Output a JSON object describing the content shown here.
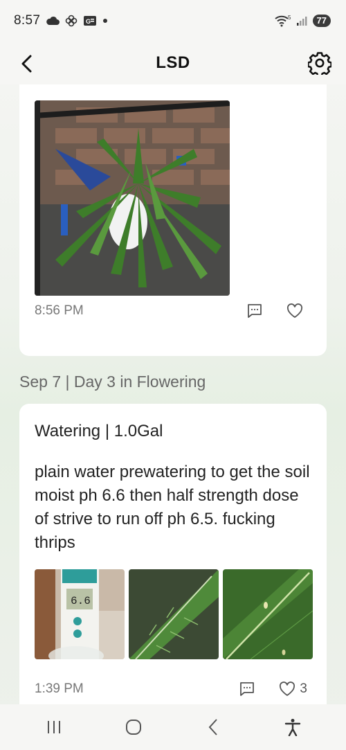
{
  "status_bar": {
    "time": "8:57",
    "icons": [
      "cloud-icon",
      "pinwheel-icon",
      "ge-badge-icon",
      "dot-icon"
    ],
    "wifi_label": "5",
    "battery": "77"
  },
  "header": {
    "title": "LSD",
    "back_icon": "chevron-left-icon",
    "settings_icon": "gear-icon"
  },
  "entries": [
    {
      "time": "8:56 PM",
      "like_count": ""
    },
    {
      "day_header": "Sep 7 | Day 3 in Flowering",
      "type": "Watering | 1.0Gal",
      "note": "plain water prewatering to get the soil moist ph 6.6 then half strength dose of strive to run off ph 6.5. fucking thrips",
      "time": "1:39 PM",
      "like_count": "3"
    }
  ],
  "colors": {
    "accent_leaf": "#3e7d2a",
    "background_tint": "#e6efe3"
  }
}
